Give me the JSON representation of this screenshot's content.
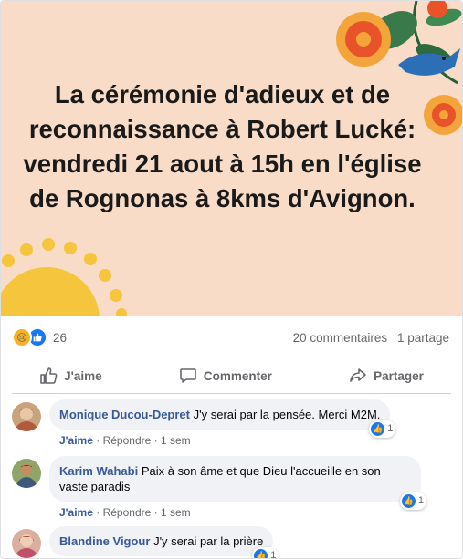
{
  "banner": {
    "text": "La cérémonie d'adieux et de reconnaissance à Robert Lucké: vendredi 21 aout à 15h en l'église de Rognonas à 8kms d'Avignon."
  },
  "stats": {
    "reaction_count": "26",
    "comments_count": "20 commentaires",
    "shares_count": "1 partage",
    "reactions": [
      "sad",
      "like"
    ]
  },
  "actions": {
    "like": "J'aime",
    "comment": "Commenter",
    "share": "Partager"
  },
  "comments": [
    {
      "author": "Monique Ducou-Depret",
      "text": "J'y serai par la pensée. Merci M2M.",
      "like_label": "J'aime",
      "reply_label": "Répondre",
      "time": "1 sem",
      "reaction_count": "1"
    },
    {
      "author": "Karim Wahabi",
      "text": "Paix à son âme et que Dieu l'accueille en son vaste paradis",
      "like_label": "J'aime",
      "reply_label": "Répondre",
      "time": "1 sem",
      "reaction_count": "1"
    },
    {
      "author": "Blandine Vigour",
      "text": "J'y serai par la prière",
      "reaction_count": "1"
    }
  ],
  "colors": {
    "banner_bg": "#f8dcc8",
    "link_blue": "#385898",
    "like_blue": "#1877f2",
    "muted": "#65676b"
  }
}
